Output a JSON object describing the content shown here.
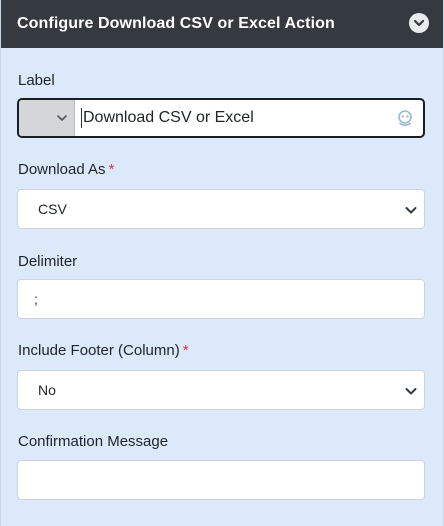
{
  "header": {
    "title": "Configure Download CSV or Excel Action",
    "collapse_icon": "chevron-down-circle-icon"
  },
  "fields": {
    "label": {
      "label": "Label",
      "value": "Download CSV or Excel",
      "icon": "ai-assist-icon"
    },
    "download_as": {
      "label": "Download As",
      "required_mark": "*",
      "value": "CSV"
    },
    "delimiter": {
      "label": "Delimiter",
      "value": ";"
    },
    "include_footer": {
      "label": "Include Footer (Column)",
      "required_mark": "*",
      "value": "No"
    },
    "confirmation_message": {
      "label": "Confirmation Message",
      "value": ""
    }
  },
  "colors": {
    "header_bg": "#343a40",
    "panel_bg": "#dbe9fa",
    "required": "#dc3545",
    "ai_icon": "#9bb8d6"
  }
}
